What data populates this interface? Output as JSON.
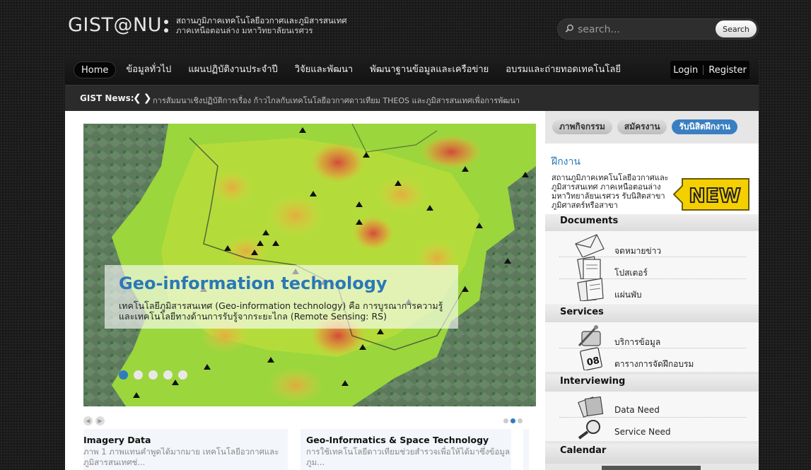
{
  "header": {
    "logo": "GIST@NU",
    "logo_sub_line1": "สถานภูมิภาคเทคโนโลยีอวกาศและภูมิสารสนเทศ",
    "logo_sub_line2": "ภาคเหนือตอนล่าง มหาวิทยาลัยนเรศวร",
    "search_placeholder": "search...",
    "search_button": "Search"
  },
  "nav": {
    "items": [
      "Home",
      "ข้อมูลทั่วไป",
      "แผนปฏิบัติงานประจำปี",
      "วิจัยและพัฒนา",
      "พัฒนาฐานข้อมูลและเครือข่าย",
      "อบรมและถ่ายทอดเทคโนโลยี"
    ],
    "login": "Login",
    "register": "Register"
  },
  "news": {
    "label": "GIST News:",
    "text": "การสัมมนาเชิงปฏิบัติการเรื่อง ก้าวไกลกับเทคโนโลยีอวกาศดาวเทียม THEOS และภูมิสารสนเทศเพื่อการพัฒนา"
  },
  "slider": {
    "title": "Geo-information technology",
    "description": "เทคโนโลยีภูมิสารสนเทศ (Geo-information technology) คือ การบูรณาการความรู้และเทคโนโลยีทางด้านการรับรู้จากระยะไกล (Remote Sensing: RS)",
    "dot_count": 5,
    "active_dot": 0
  },
  "cards": [
    {
      "title": "Imagery Data",
      "text": "ภาพ 1 ภาพแทนคำพูดได้มากมาย เทคโนโลยีอวกาศและภูมิสารสนเทศช่..."
    },
    {
      "title": "Geo-Informatics & Space Technology",
      "text": "การใช้เทคโนโลยีดาวเทียมช่วยสำรวจเพื่อให้ได้มาซึ่งข้อมูลภูม..."
    }
  ],
  "sidebar": {
    "tabs": [
      "ภาพกิจกรรม",
      "สมัครงาน",
      "รับนิสิตฝึกงาน"
    ],
    "active_tab": 2,
    "panel_title": "ฝึกงาน",
    "panel_text": "สถานภูมิภาคเทคโนโลยีอวกาศและภูมิสารสนเทศ ภาคเหนือตอนล่าง มหาวิทยาลัยนเรศวร รับนิสิตสาขาภูมิศาสตร์หรือสาขา",
    "new_badge": "NEW",
    "documents_header": "Documents",
    "documents": [
      "จดหมายข่าว",
      "โปสเตอร์",
      "แผ่นพับ"
    ],
    "services_header": "Services",
    "services": [
      "บริการข้อมูล",
      "ตารางการจัดฝึกอบรม"
    ],
    "interviewing_header": "Interviewing",
    "interviewing": [
      "Data Need",
      "Service Need"
    ],
    "calendar_header": "Calendar"
  },
  "colors": {
    "accent": "#2e7bc1",
    "nav_bg": "#121212",
    "page_bg": "#1a1a1a"
  }
}
